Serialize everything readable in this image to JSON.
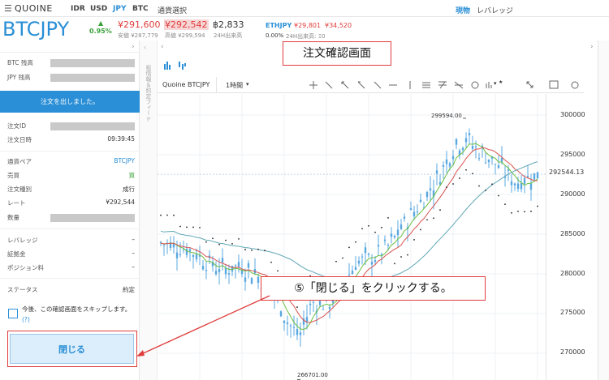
{
  "topnav": {
    "menu_icon": "menu-icon",
    "brand": "QUOINE",
    "currencies": [
      "IDR",
      "USD",
      "JPY",
      "BTC"
    ],
    "currency_select": "通貨選択",
    "modes": [
      "現物",
      "レバレッジ"
    ]
  },
  "ticker": {
    "pair": "BTCJPY",
    "change": "0.95%",
    "bid": "¥291,600",
    "bid_sub": "安値 ¥287,779",
    "ask": "¥292,542",
    "ask_sub": "高値 ¥299,594",
    "volume": "฿2,833",
    "volume_sub": "24H出来高",
    "other_pair": "ETHJPY",
    "other_bid": "¥29,801",
    "other_ask": "¥34,520",
    "other_change": "0.00%",
    "other_volume_label": "24H出来高: Ξ0"
  },
  "left_panel": {
    "btc_balance_label": "BTC 残高",
    "jpy_balance_label": "JPY 残高",
    "notice": "注文を出しました。",
    "order_id_label": "注文ID",
    "order_time_label": "注文日時",
    "order_time": "09:39:45",
    "pair_label": "通貨ペア",
    "pair_value": "BTCJPY",
    "side_label": "売買",
    "side_value": "買",
    "type_label": "注文種別",
    "type_value": "成行",
    "rate_label": "レート",
    "rate_value": "¥292,544",
    "qty_label": "数量",
    "leverage_label": "レバレッジ",
    "leverage_value": "–",
    "margin_label": "証拠金",
    "margin_value": "–",
    "position_fee_label": "ポジション料",
    "position_fee_value": "–",
    "status_label": "ステータス",
    "status_value": "約定",
    "skip_text": "今後、この確認画面をスキップします。",
    "help": "(?)",
    "close_button": "閉じる"
  },
  "vertical_strip_text": "板情報＆約定フィード",
  "chart": {
    "symbol": "Quoine BTCJPY",
    "interval": "1時間",
    "price_label": "292544.13",
    "high_label": "299594.00",
    "low_label": "266701.00",
    "y_ticks": [
      "300000",
      "295000",
      "290000",
      "285000",
      "280000",
      "275000",
      "270000"
    ]
  },
  "callouts": {
    "title": "注文確認画面",
    "instruction": "⑤「閉じる」をクリックする。"
  },
  "colors": {
    "accent": "#2a8fd6",
    "red": "#e03c3c",
    "green": "#3aa13a",
    "candle": "#5aa8e0"
  }
}
